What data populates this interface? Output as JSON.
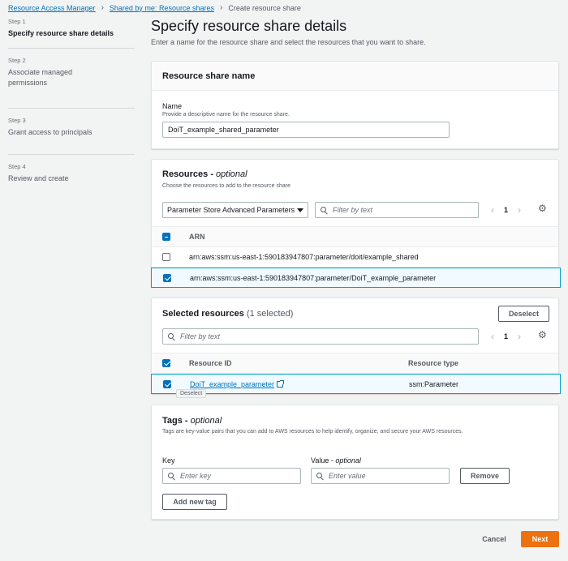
{
  "breadcrumb": {
    "items": [
      "Resource Access Manager",
      "Shared by me: Resource shares"
    ],
    "current": "Create resource share"
  },
  "steps": [
    {
      "num": "Step 1",
      "title": "Specify resource share details"
    },
    {
      "num": "Step 2",
      "title": "Associate managed permissions"
    },
    {
      "num": "Step 3",
      "title": "Grant access to principals"
    },
    {
      "num": "Step 4",
      "title": "Review and create"
    }
  ],
  "page": {
    "title": "Specify resource share details",
    "description": "Enter a name for the resource share and select the resources that you want to share."
  },
  "share_name": {
    "header": "Resource share name",
    "label": "Name",
    "hint": "Provide a descriptive name for the resource share.",
    "value": "DoiT_example_shared_parameter"
  },
  "resources": {
    "header": "Resources",
    "optional": "optional",
    "sub": "Choose the resources to add to the resource share",
    "type_selected": "Parameter Store Advanced Parameters",
    "filter_placeholder": "Filter by text",
    "page": "1",
    "column": "ARN",
    "rows": [
      {
        "arn": "arn:aws:ssm:us-east-1:590183947807:parameter/doit/example_shared",
        "checked": false
      },
      {
        "arn": "arn:aws:ssm:us-east-1:590183947807:parameter/DoiT_example_parameter",
        "checked": true
      }
    ]
  },
  "selected": {
    "header": "Selected resources",
    "count": "(1 selected)",
    "deselect_label": "Deselect",
    "filter_placeholder": "Filter by text",
    "page": "1",
    "col_id": "Resource ID",
    "col_type": "Resource type",
    "row": {
      "id": "DoiT_example_parameter",
      "type": "ssm:Parameter"
    },
    "tooltip": "Deselect"
  },
  "tags": {
    "header": "Tags",
    "optional": "optional",
    "sub": "Tags are key-value pairs that you can add to AWS resources to help identify, organize, and secure your AWS resources.",
    "key_label": "Key",
    "value_label": "Value",
    "key_placeholder": "Enter key",
    "value_placeholder": "Enter value",
    "remove_label": "Remove",
    "add_label": "Add new tag"
  },
  "footer": {
    "cancel_label": "Cancel",
    "next_label": "Next"
  }
}
